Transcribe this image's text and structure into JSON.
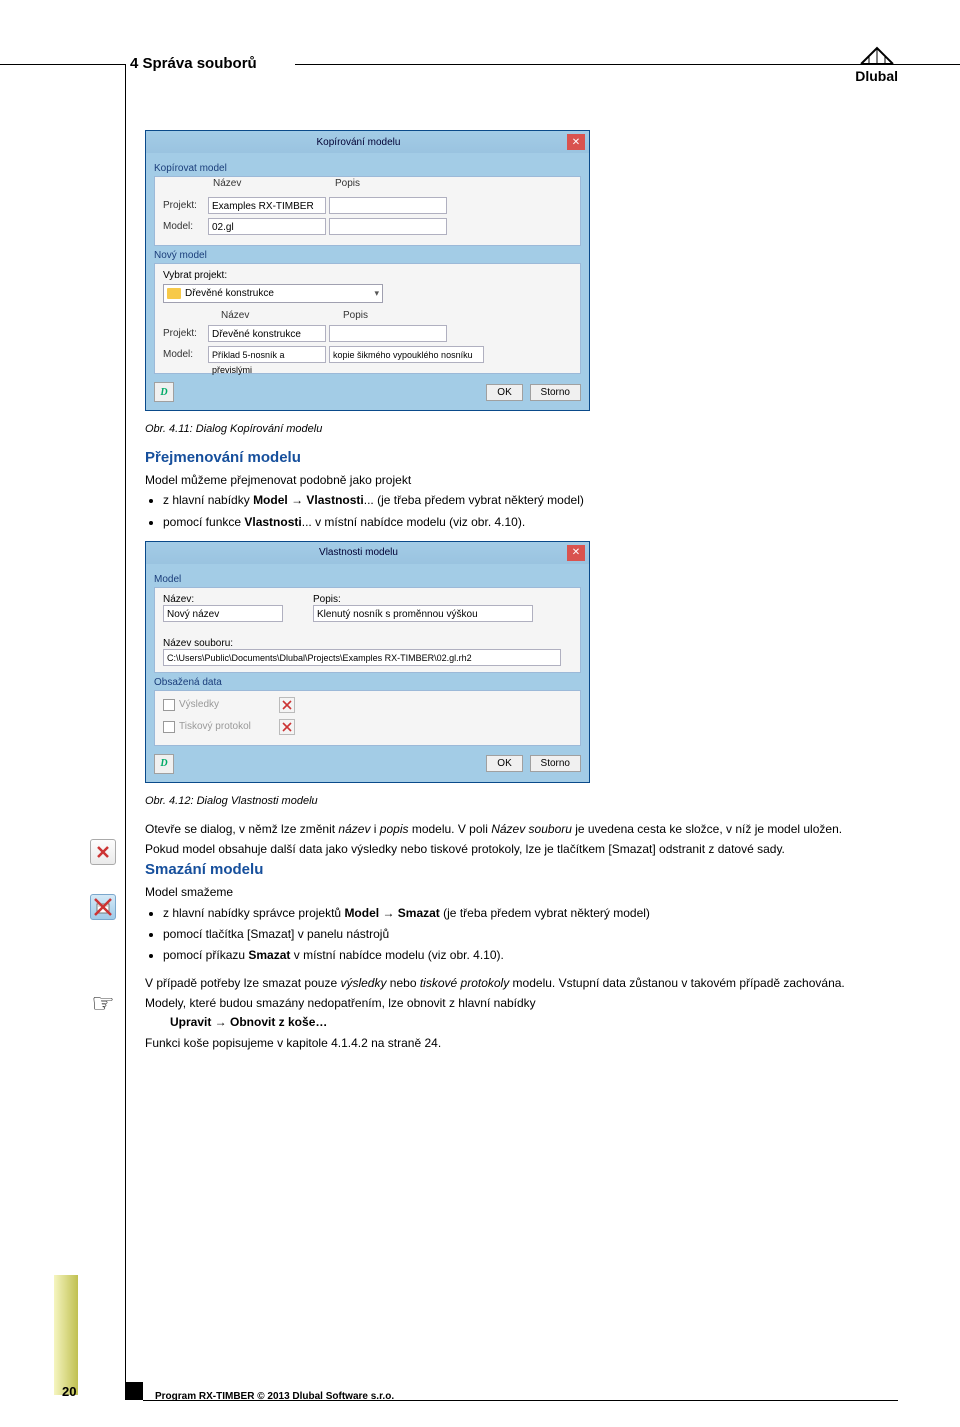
{
  "header": {
    "section": "4 Správa souborů",
    "logo": "Dlubal"
  },
  "dlg1": {
    "title": "Kopírování modelu",
    "s1": "Kopírovat model",
    "col_name": "Název",
    "col_desc": "Popis",
    "r1l": "Projekt:",
    "r1v": "Examples RX-TIMBER",
    "r2l": "Model:",
    "r2v": "02.gl",
    "s2": "Nový model",
    "sel_lbl": "Vybrat projekt:",
    "sel_val": "Dřevěné konstrukce",
    "r3l": "Projekt:",
    "r3v": "Dřevěné konstrukce",
    "r4l": "Model:",
    "r4v": "Příklad 5-nosník a převislými",
    "r4d": "kopie šikmého vypouklého nosníku",
    "ok": "OK",
    "cancel": "Storno"
  },
  "cap1": "Obr. 4.11: Dialog Kopírování modelu",
  "h1": "Přejmenování modelu",
  "p1": "Model můžeme přejmenovat podobně jako projekt",
  "b1a1": "z hlavní nabídky ",
  "b1a2": "Model",
  "b1a3": " → ",
  "b1a4": "Vlastnosti",
  "b1a5": "... (je třeba předem vybrat některý model)",
  "b1b1": "pomocí funkce ",
  "b1b2": "Vlastnosti",
  "b1b3": "... v místní nabídce modelu (viz obr. 4.10).",
  "dlg2": {
    "title": "Vlastnosti modelu",
    "s1": "Model",
    "nl": "Název:",
    "nv": "Nový název",
    "pl": "Popis:",
    "pv": "Klenutý nosník s proměnnou výškou",
    "fl": "Název souboru:",
    "fv": "C:\\Users\\Public\\Documents\\Dlubal\\Projects\\Examples RX-TIMBER\\02.gl.rh2",
    "s2": "Obsažená data",
    "c1": "Výsledky",
    "c2": "Tiskový protokol",
    "ok": "OK",
    "cancel": "Storno"
  },
  "cap2": "Obr. 4.12: Dialog Vlastnosti modelu",
  "p2a": "Otevře se dialog, v němž lze změnit ",
  "p2b": "název",
  "p2c": " i ",
  "p2d": "popis",
  "p2e": " modelu. V poli ",
  "p2f": "Název souboru",
  "p2g": " je uvedena cesta ke složce, v níž je model uložen.",
  "p3": "Pokud model obsahuje další data jako výsledky nebo tiskové protokoly, lze je tlačítkem [Smazat] odstranit z datové sady.",
  "h2": "Smazání modelu",
  "p4": "Model smažeme",
  "b2a1": "z hlavní nabídky správce projektů ",
  "b2a2": "Model",
  "b2a3": " → ",
  "b2a4": "Smazat",
  "b2a5": " (je třeba předem vybrat některý model)",
  "b2b": "pomocí tlačítka [Smazat] v panelu nástrojů",
  "b2c1": "pomocí příkazu ",
  "b2c2": "Smazat",
  "b2c3": " v místní nabídce modelu (viz obr. 4.10).",
  "p5a": "V případě potřeby lze smazat pouze ",
  "p5b": "výsledky",
  "p5c": " nebo ",
  "p5d": "tiskové protokoly",
  "p5e": " modelu. Vstupní data zůstanou v takovém případě zachována.",
  "p6": "Modely, které budou smazány nedopatřením, lze obnovit z hlavní nabídky",
  "cmd1": "Upravit",
  "cmd2": " → ",
  "cmd3": "Obnovit z koše…",
  "p7": "Funkci koše popisujeme v kapitole 4.1.4.2 na straně 24.",
  "footer": {
    "page": "20",
    "text": "Program RX-TIMBER © 2013 Dlubal Software s.r.o."
  }
}
